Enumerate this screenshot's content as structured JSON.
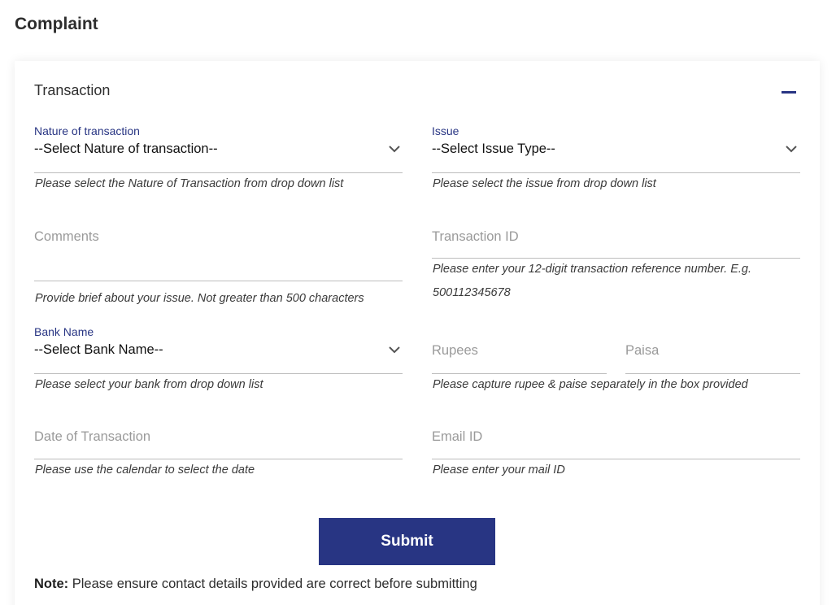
{
  "page": {
    "title": "Complaint"
  },
  "section": {
    "title": "Transaction"
  },
  "nature": {
    "label": "Nature of transaction",
    "value": "--Select Nature of transaction--",
    "hint": "Please select the Nature of Transaction from drop down list"
  },
  "issue": {
    "label": "Issue",
    "value": "--Select Issue Type--",
    "hint": "Please select the issue from drop down list"
  },
  "comments": {
    "placeholder": "Comments",
    "hint": "Provide brief about your issue. Not greater than 500 characters"
  },
  "transaction_id": {
    "placeholder": "Transaction ID",
    "hint_line1": "Please enter your 12-digit transaction reference number. E.g.",
    "hint_line2": "500112345678"
  },
  "bank": {
    "label": "Bank Name",
    "value": "--Select Bank Name--",
    "hint": "Please select your bank from drop down list"
  },
  "amount": {
    "rupees_placeholder": "Rupees",
    "paisa_placeholder": "Paisa",
    "hint": "Please capture rupee & paise separately in the box provided"
  },
  "date": {
    "placeholder": "Date of Transaction",
    "hint": "Please use the calendar to select the date"
  },
  "email": {
    "placeholder": "Email ID",
    "hint": "Please enter your mail ID"
  },
  "submit": {
    "label": "Submit"
  },
  "note": {
    "label": "Note:",
    "text": "Please ensure contact details provided are correct before submitting"
  },
  "colors": {
    "accent": "#283583",
    "underline": "#bdbdbd",
    "placeholder": "#9a9a9a"
  },
  "icons": {
    "dropdown": "chevron-down-icon",
    "collapse": "minus-icon"
  }
}
